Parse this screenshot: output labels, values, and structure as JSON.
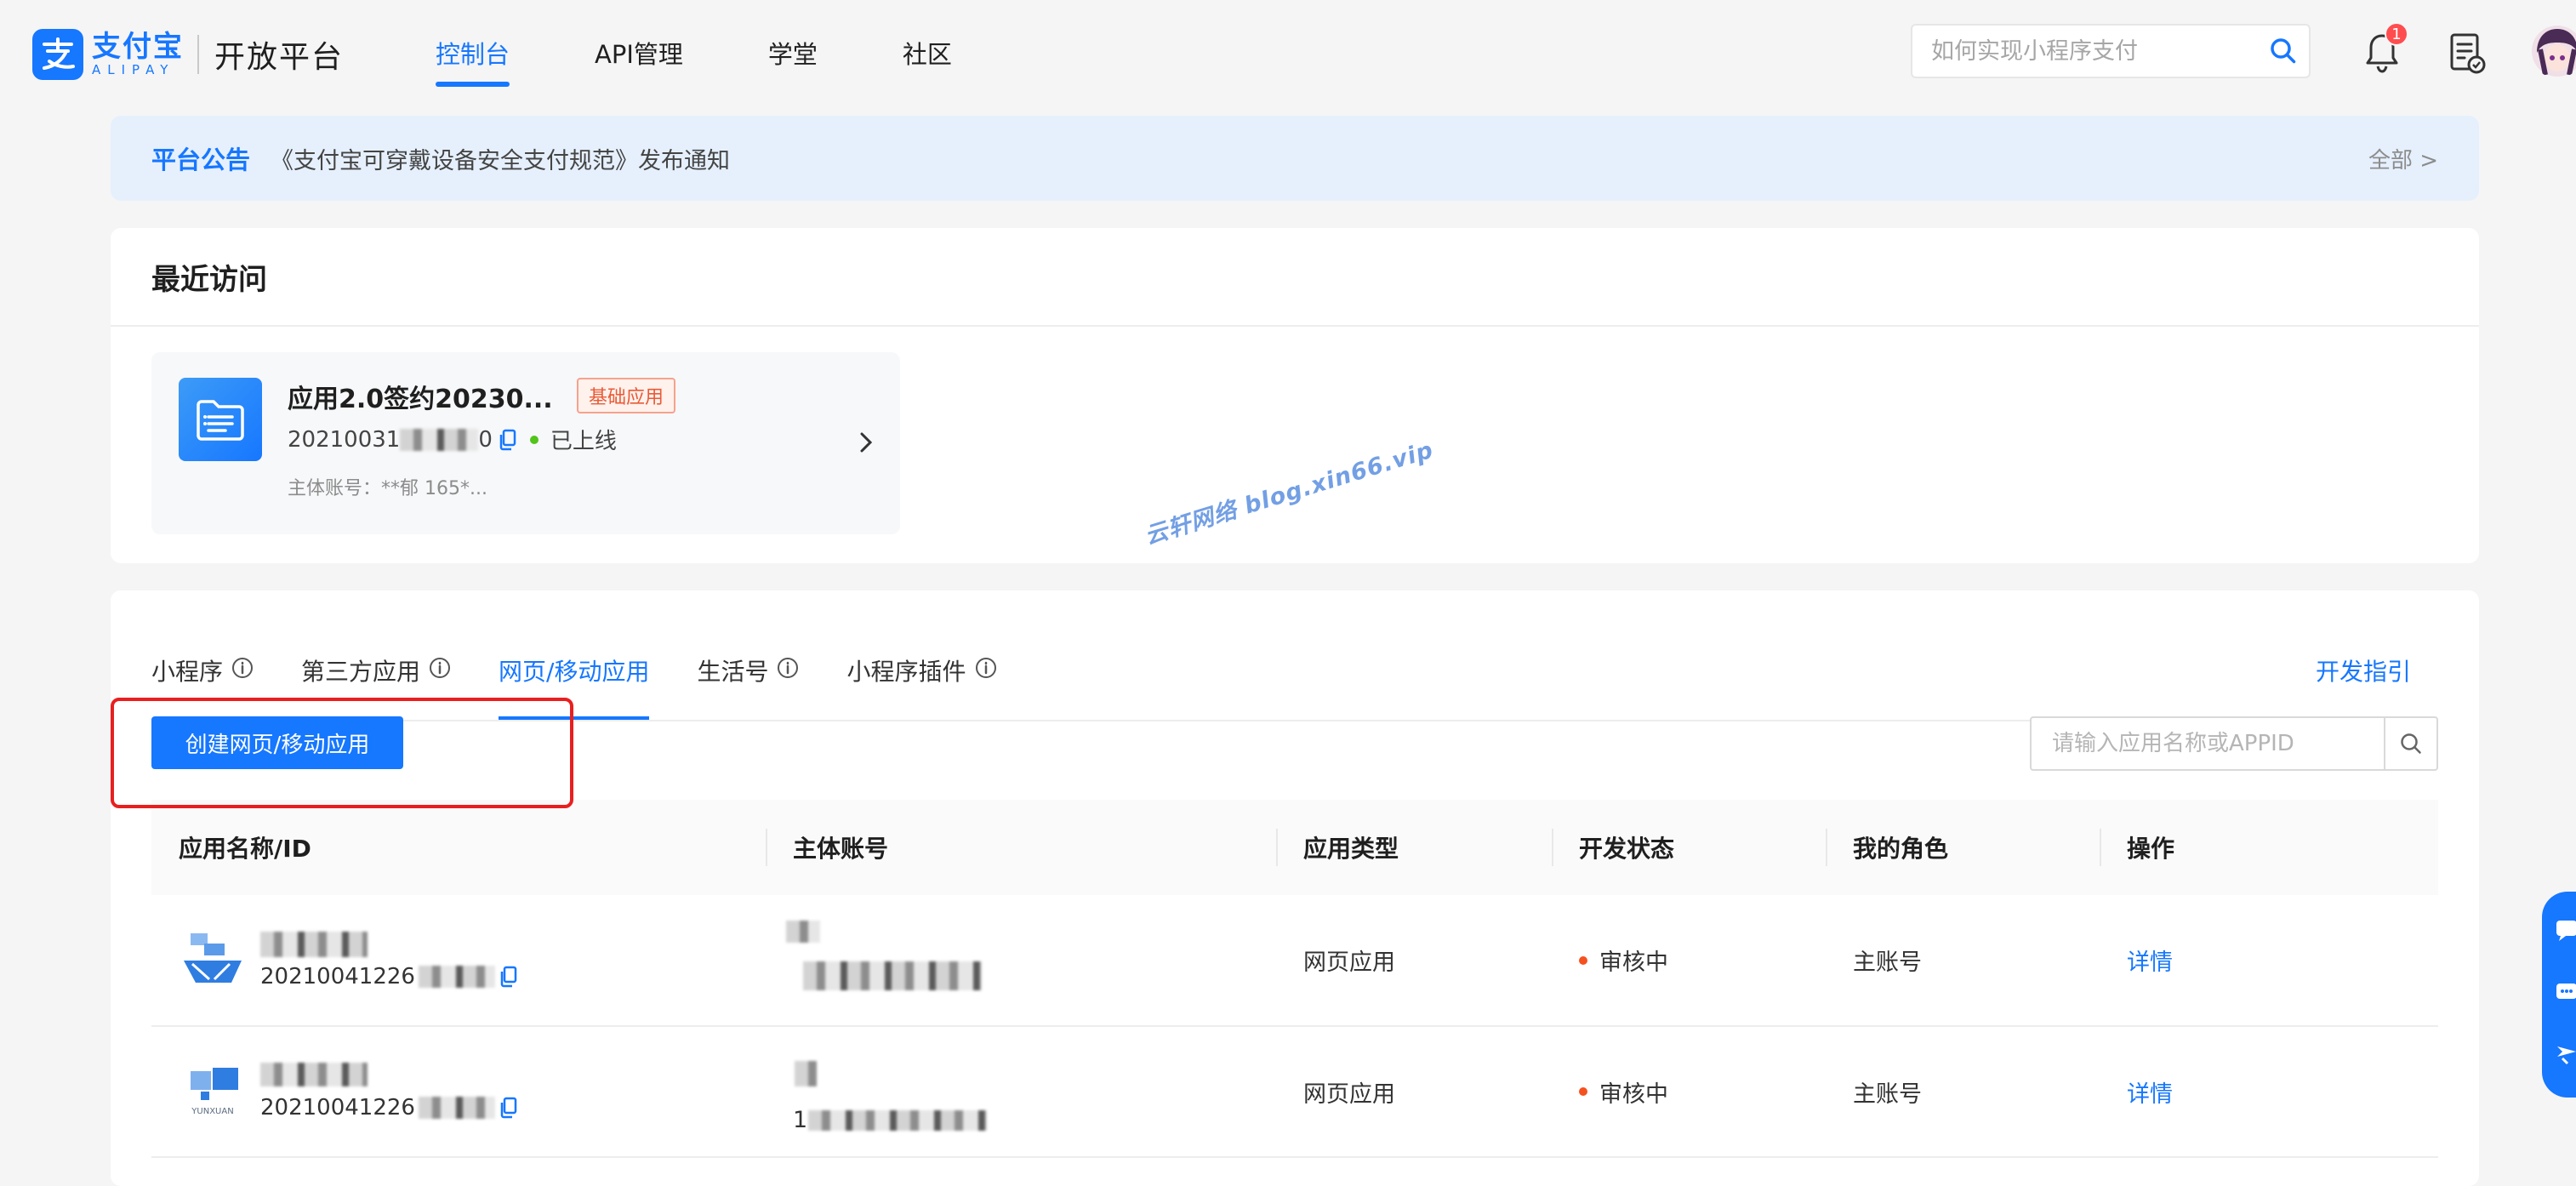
{
  "header": {
    "logo_cn": "支付宝",
    "logo_en": "ALIPAY",
    "platform": "开放平台",
    "nav": [
      {
        "label": "控制台",
        "active": true
      },
      {
        "label": "API管理",
        "active": false
      },
      {
        "label": "学堂",
        "active": false
      },
      {
        "label": "社区",
        "active": false
      }
    ],
    "search_placeholder": "如何实现小程序支付",
    "notification_count": "1",
    "icons": [
      "search-icon",
      "bell-icon",
      "document-check-icon",
      "avatar"
    ]
  },
  "notice": {
    "title": "平台公告",
    "text": "《支付宝可穿戴设备安全支付规范》发布通知",
    "more": "全部 >"
  },
  "recent": {
    "title": "最近访问",
    "app": {
      "name": "应用2.0签约20230...",
      "tag": "基础应用",
      "id_visible": "20210031",
      "id_tail": "0",
      "status": "已上线",
      "owner": "主体账号：**郁  165*..."
    }
  },
  "watermark": "云轩网络  blog.xin66.vip",
  "apps_panel": {
    "tabs": [
      {
        "label": "小程序",
        "info": true,
        "active": false
      },
      {
        "label": "第三方应用",
        "info": true,
        "active": false
      },
      {
        "label": "网页/移动应用",
        "info": false,
        "active": true
      },
      {
        "label": "生活号",
        "info": true,
        "active": false
      },
      {
        "label": "小程序插件",
        "info": true,
        "active": false
      }
    ],
    "dev_guide": "开发指引",
    "create_button": "创建网页/移动应用",
    "search_placeholder": "请输入应用名称或APPID",
    "columns": [
      "应用名称/ID",
      "主体账号",
      "应用类型",
      "开发状态",
      "我的角色",
      "操作"
    ],
    "rows": [
      {
        "id": "20210041226",
        "type": "网页应用",
        "status": "审核中",
        "role": "主账号",
        "action": "详情"
      },
      {
        "id": "20210041226",
        "type": "网页应用",
        "status": "审核中",
        "role": "主账号",
        "action": "详情",
        "owner_prefix": "1",
        "icon_caption": "YUNXUAN"
      }
    ]
  },
  "colors": {
    "primary": "#1677ff",
    "notice_bg": "#e6f0fd",
    "status_online": "#52c41a",
    "status_review": "#f5511e",
    "highlight_border": "#e91f1f",
    "tag_text": "#e85b37"
  }
}
